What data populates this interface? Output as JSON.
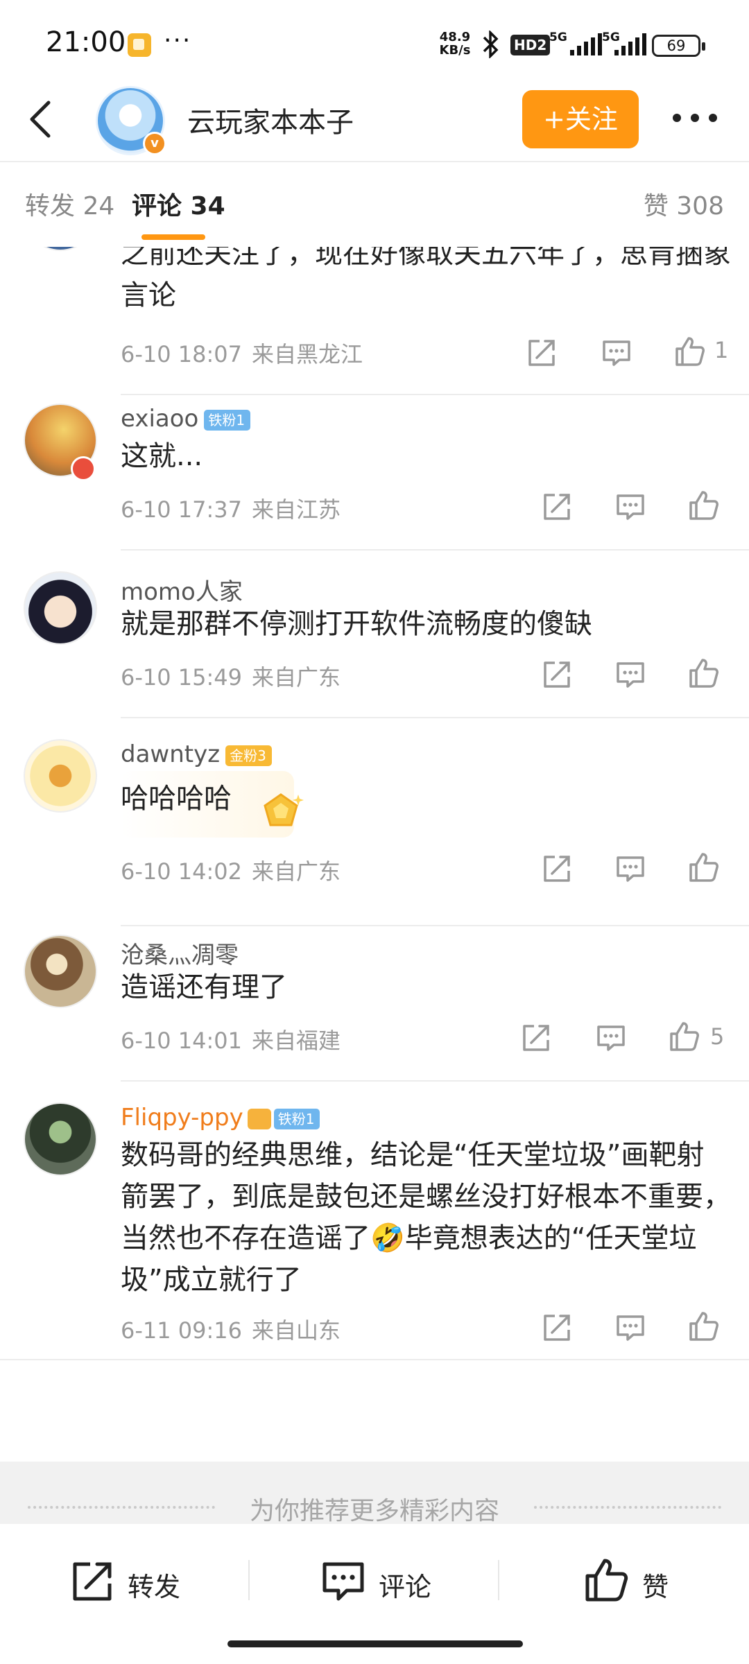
{
  "status_bar": {
    "time": "21:00",
    "more": "···",
    "network_speed_value": "48.9",
    "network_speed_unit": "KB/s",
    "hd": "HD2",
    "signal1": "5G",
    "signal2": "5G",
    "battery": "69"
  },
  "header": {
    "username": "云玩家本本子",
    "verified_badge": "v",
    "follow_label": "+关注",
    "more_icon": "more-icon",
    "back_icon": "back-icon"
  },
  "tabs": {
    "repost": "转发 24",
    "comment": "评论 34",
    "like": "赞 308"
  },
  "comments": [
    {
      "name": "",
      "text": "之前还关注了，现在好像取关五六年了，思肯捆象言论",
      "date": "6-10 18:07",
      "location": "来自黑龙江",
      "likes": "1"
    },
    {
      "name": "exiaoo",
      "badge": "铁粉1",
      "text": "这就...",
      "date": "6-10 17:37",
      "location": "来自江苏",
      "likes": ""
    },
    {
      "name": "momo人家",
      "text": "就是那群不停测打开软件流畅度的傻缺",
      "date": "6-10 15:49",
      "location": "来自广东",
      "likes": ""
    },
    {
      "name": "dawntyz",
      "badge": "金粉3",
      "text": "哈哈哈哈",
      "date": "6-10 14:02",
      "location": "来自广东",
      "likes": ""
    },
    {
      "name": "沧桑灬凋零",
      "text": "造谣还有理了",
      "date": "6-10 14:01",
      "location": "来自福建",
      "likes": "5"
    },
    {
      "name": "Fliqpy-ppy",
      "badge": "铁粉1",
      "text": "数码哥的经典思维，结论是“任天堂垃圾”画靶射箭罢了，到底是鼓包还是螺丝没打好根本不重要，当然也不存在造谣了🤣毕竟想表达的“任天堂垃圾”成立就行了",
      "date": "6-11 09:16",
      "location": "来自山东",
      "likes": ""
    }
  ],
  "recommend": {
    "text": "为你推荐更多精彩内容"
  },
  "bottom_bar": {
    "repost": "转发",
    "comment": "评论",
    "like": "赞"
  },
  "colors": {
    "accent": "#ff9712",
    "text": "#222222",
    "meta": "#9a9a9a",
    "iron_fan": "#6fb6ee",
    "gold_fan": "#f8b934"
  }
}
